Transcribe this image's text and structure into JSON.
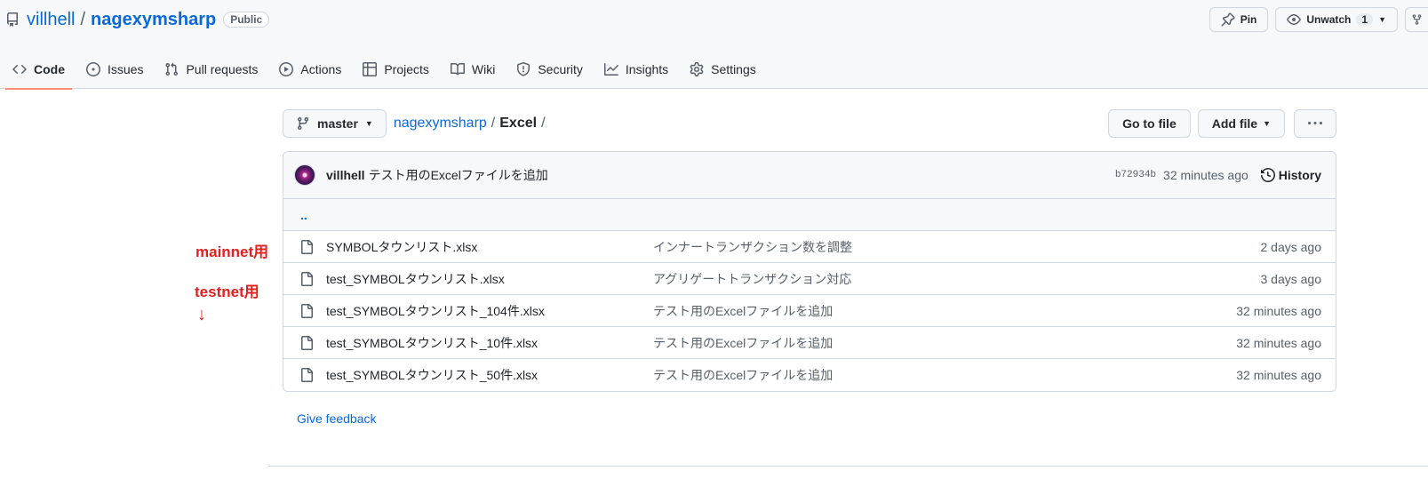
{
  "repo": {
    "owner": "villhell",
    "slash": "/",
    "name": "nagexymsharp",
    "visibility": "Public"
  },
  "header_actions": {
    "pin": "Pin",
    "unwatch": "Unwatch",
    "watch_count": "1"
  },
  "tabs": [
    {
      "label": "Code",
      "icon": "code-icon",
      "active": true
    },
    {
      "label": "Issues",
      "icon": "issue-icon"
    },
    {
      "label": "Pull requests",
      "icon": "pull-request-icon"
    },
    {
      "label": "Actions",
      "icon": "play-icon"
    },
    {
      "label": "Projects",
      "icon": "table-icon"
    },
    {
      "label": "Wiki",
      "icon": "book-icon"
    },
    {
      "label": "Security",
      "icon": "shield-icon"
    },
    {
      "label": "Insights",
      "icon": "graph-icon"
    },
    {
      "label": "Settings",
      "icon": "gear-icon"
    }
  ],
  "annotations": {
    "mainnet": "mainnet用",
    "testnet": "testnet用",
    "arrow": "↓"
  },
  "branch": "master",
  "path": {
    "root": "nagexymsharp",
    "sep": "/",
    "segment": "Excel",
    "trailing": "/"
  },
  "toolbar": {
    "go_to_file": "Go to file",
    "add_file": "Add file"
  },
  "commit": {
    "author": "villhell",
    "message": "テスト用のExcelファイルを追加",
    "sha": "b72934b",
    "time": "32 minutes ago",
    "history": "History"
  },
  "parent_dir": "..",
  "files": [
    {
      "name": "SYMBOLタウンリスト.xlsx",
      "message": "インナートランザクション数を調整",
      "date": "2 days ago"
    },
    {
      "name": "test_SYMBOLタウンリスト.xlsx",
      "message": "アグリゲートトランザクション対応",
      "date": "3 days ago"
    },
    {
      "name": "test_SYMBOLタウンリスト_104件.xlsx",
      "message": "テスト用のExcelファイルを追加",
      "date": "32 minutes ago"
    },
    {
      "name": "test_SYMBOLタウンリスト_10件.xlsx",
      "message": "テスト用のExcelファイルを追加",
      "date": "32 minutes ago"
    },
    {
      "name": "test_SYMBOLタウンリスト_50件.xlsx",
      "message": "テスト用のExcelファイルを追加",
      "date": "32 minutes ago"
    }
  ],
  "feedback": "Give feedback",
  "colors": {
    "link": "#0969da",
    "active_tab_underline": "#fd8c73",
    "annotation": "#e0211d",
    "border": "#d0d7de"
  }
}
